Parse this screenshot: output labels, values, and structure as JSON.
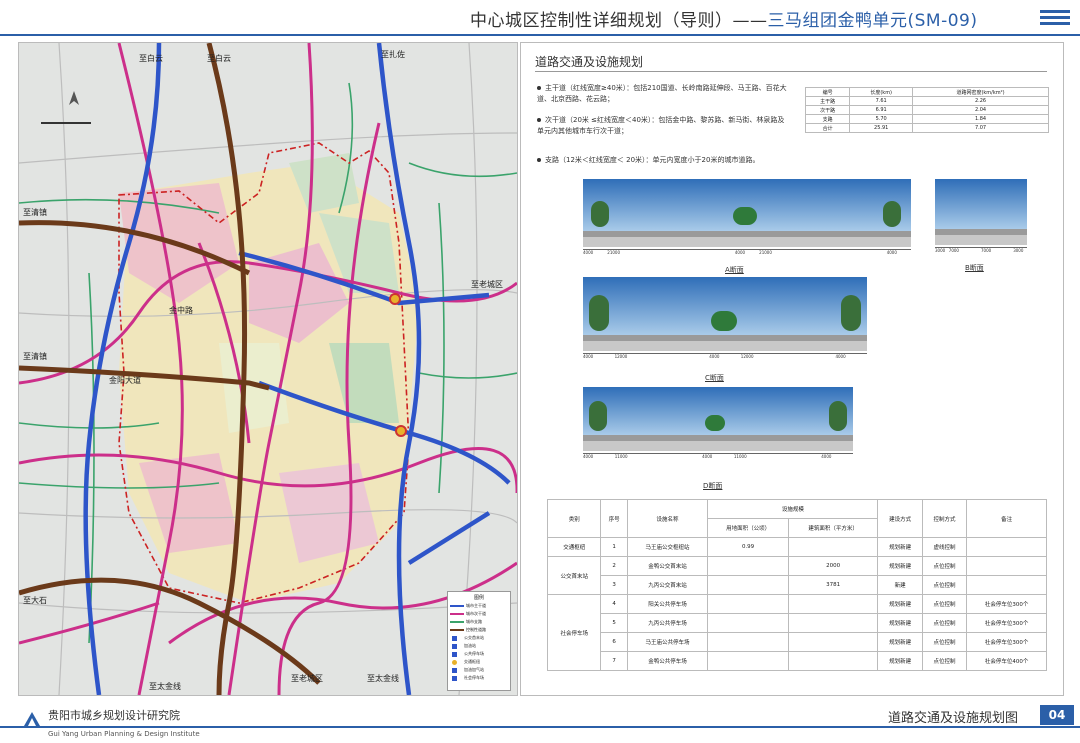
{
  "header": {
    "title_main": "中心城区控制性详细规划（导则）——",
    "title_sub": "三马组团金鸭单元(SM-09)"
  },
  "map": {
    "place_labels": {
      "baiyun_1": "至白云",
      "baiyun_2": "至白云",
      "zhazuo": "至扎佐",
      "qingzhen_1": "至清镇",
      "qingzhen_2": "至清镇",
      "laocheng_1": "至老城区",
      "laocheng_2": "至老城区",
      "dazha": "至大石",
      "taijin_1": "至太金线",
      "taijin_2": "至太金线",
      "jinzhong_rd": "金中路",
      "jinyang_rd": "金阳大道"
    },
    "legend": {
      "title": "图例",
      "items": [
        "城市主干道",
        "城市次干道",
        "城市支路",
        "控制性道路",
        "公交首末站",
        "加油站",
        "公共停车场",
        "交通枢纽",
        "加油加气站",
        "社会停车场"
      ]
    }
  },
  "panel": {
    "title": "道路交通及设施规划",
    "bullets": [
      "主干道（红线宽度≥40米）：包括210国道、长岭南路延伸段、马王路、百花大道、北京西路、花云路；",
      "次干道（20米 ≤红线宽度＜40米）：包括金中路、黎苏路、新马街、林泉路及单元内其他城市车行次干道；",
      "支路（12米＜红线宽度＜ 20米）：单元内宽度小于20米的城市道路。"
    ],
    "density_table": {
      "headers": [
        "编号",
        "长度(km)",
        "道路网密度(km/km²)"
      ],
      "rows": [
        [
          "主干路",
          "7.61",
          "2.26"
        ],
        [
          "次干路",
          "6.91",
          "2.04"
        ],
        [
          "支路",
          "5.70",
          "1.84"
        ],
        [
          "合计",
          "25.91",
          "7.07"
        ]
      ]
    },
    "sections": [
      {
        "label": "A断面",
        "dims": [
          "4000",
          "21000",
          "4000",
          "21000",
          "4000"
        ]
      },
      {
        "label": "B断面",
        "dims": [
          "3000",
          "7000",
          "7000",
          "3000"
        ]
      },
      {
        "label": "C断面",
        "dims": [
          "4000",
          "12000",
          "4000",
          "12000",
          "4000"
        ]
      },
      {
        "label": "D断面",
        "dims": [
          "4000",
          "11000",
          "4000",
          "11000",
          "4000"
        ]
      }
    ],
    "facility_table": {
      "headers": [
        "类别",
        "序号",
        "设施名称",
        "设施规模",
        "建设方式",
        "控制方式",
        "备注"
      ],
      "subheaders": [
        "用地面积（公顷）",
        "建筑面积（平方米）"
      ],
      "rows": [
        [
          "交通枢纽",
          "1",
          "马王庙公交枢纽站",
          "0.99",
          "",
          "规划新建",
          "虚线控制",
          ""
        ],
        [
          "公交首末站",
          "2",
          "金鸭公交首末站",
          "",
          "2000",
          "规划新建",
          "点位控制",
          ""
        ],
        [
          "",
          "3",
          "九丙公交首末站",
          "",
          "3781",
          "新建",
          "点位控制",
          ""
        ],
        [
          "社会停车场",
          "4",
          "阳关公共停车场",
          "",
          "",
          "规划新建",
          "点位控制",
          "社会停车位300个"
        ],
        [
          "",
          "5",
          "九丙公共停车场",
          "",
          "",
          "规划新建",
          "点位控制",
          "社会停车位300个"
        ],
        [
          "",
          "6",
          "马王庙公共停车场",
          "",
          "",
          "规划新建",
          "点位控制",
          "社会停车位300个"
        ],
        [
          "",
          "7",
          "金鸭公共停车场",
          "",
          "",
          "规划新建",
          "点位控制",
          "社会停车位400个"
        ]
      ]
    }
  },
  "footer": {
    "institute": "贵阳市城乡规划设计研究院",
    "institute_en": "Gui Yang Urban Planning & Design Institute",
    "title": "道路交通及设施规划图",
    "page": "04"
  },
  "colors": {
    "brand": "#2b5fa8",
    "arterial": "#2e55c9",
    "secondary": "#cc2f8a",
    "control": "#6b3a1a",
    "unit_boundary": "#cc2222"
  }
}
